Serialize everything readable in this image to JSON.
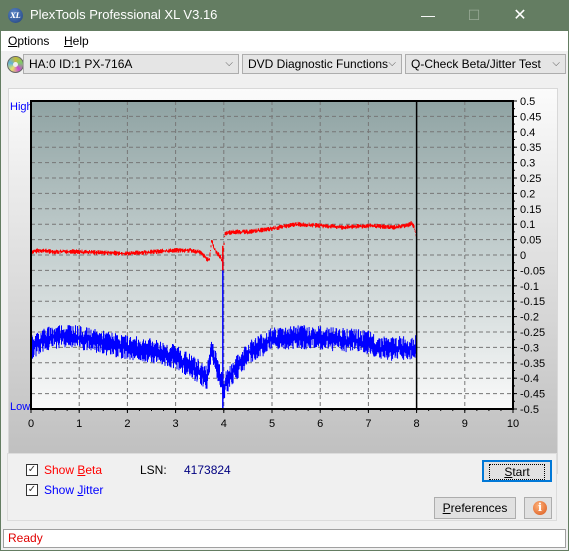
{
  "window": {
    "title": "PlexTools Professional XL V3.16",
    "app_icon": "XL",
    "controls": {
      "minimize": "—",
      "maximize": "☐",
      "close": "✕"
    }
  },
  "menu": {
    "items": [
      {
        "label": "Options",
        "accel": "O",
        "rest": "ptions"
      },
      {
        "label": "Help",
        "accel": "H",
        "rest": "elp"
      }
    ]
  },
  "toolbar": {
    "drive_icon": "disc-icon",
    "drive": "HA:0 ID:1  PX-716A",
    "function": "DVD Diagnostic Functions",
    "test": "Q-Check Beta/Jitter Test",
    "chevron": "⌵"
  },
  "chart_data": {
    "type": "line",
    "title": "",
    "xlabel": "",
    "ylabel": "",
    "left_axis_labels": {
      "high": "High",
      "low": "Low"
    },
    "xlim": [
      0,
      10
    ],
    "ylim": [
      -0.5,
      0.5
    ],
    "x_ticks": [
      0,
      1,
      2,
      3,
      4,
      5,
      6,
      7,
      8,
      9,
      10
    ],
    "y_ticks": [
      0.5,
      0.45,
      0.4,
      0.35,
      0.3,
      0.25,
      0.2,
      0.15,
      0.1,
      0.05,
      0,
      -0.05,
      -0.1,
      -0.15,
      -0.2,
      -0.25,
      -0.3,
      -0.35,
      -0.4,
      -0.45,
      -0.5
    ],
    "y_tick_labels": [
      "0.5",
      "0.45",
      "0.4",
      "0.35",
      "0.3",
      "0.25",
      "0.2",
      "0.15",
      "0.1",
      "0.05",
      "0",
      "-0.05",
      "-0.1",
      "-0.15",
      "-0.2",
      "-0.25",
      "-0.3",
      "-0.35",
      "-0.4",
      "-0.45",
      "-0.5"
    ],
    "grid": true,
    "marker_x": 8,
    "series": [
      {
        "name": "Beta",
        "color": "#ff0000",
        "x": [
          0,
          0.2,
          0.5,
          0.8,
          1.0,
          1.5,
          2.0,
          2.5,
          3.0,
          3.3,
          3.5,
          3.6,
          3.7,
          3.75,
          3.8,
          3.9,
          3.98,
          4.02,
          4.2,
          4.5,
          5.0,
          5.5,
          6.0,
          6.5,
          7.0,
          7.5,
          7.8,
          7.9,
          7.95,
          8.0
        ],
        "y": [
          0.01,
          0.015,
          0.01,
          0.012,
          0.01,
          0.008,
          0.005,
          0.01,
          0.015,
          0.015,
          0.01,
          -0.005,
          -0.02,
          0.05,
          0.02,
          0.0,
          -0.02,
          0.07,
          0.075,
          0.075,
          0.085,
          0.1,
          0.095,
          0.09,
          0.095,
          0.09,
          0.095,
          0.105,
          0.09,
          0.06
        ],
        "noise": 0.008
      },
      {
        "name": "Jitter",
        "color": "#0000ff",
        "x": [
          0,
          0.2,
          0.5,
          0.8,
          1.0,
          1.5,
          2.0,
          2.5,
          3.0,
          3.3,
          3.5,
          3.65,
          3.75,
          3.85,
          3.95,
          4.0,
          4.1,
          4.3,
          4.5,
          4.8,
          5.0,
          5.5,
          6.0,
          6.5,
          7.0,
          7.2,
          7.5,
          7.8,
          8.0
        ],
        "y": [
          -0.3,
          -0.28,
          -0.265,
          -0.26,
          -0.27,
          -0.285,
          -0.3,
          -0.31,
          -0.33,
          -0.36,
          -0.38,
          -0.4,
          -0.3,
          -0.36,
          -0.4,
          -0.43,
          -0.4,
          -0.36,
          -0.32,
          -0.29,
          -0.275,
          -0.265,
          -0.27,
          -0.275,
          -0.285,
          -0.3,
          -0.305,
          -0.3,
          -0.3
        ],
        "noise": 0.025
      }
    ]
  },
  "controls": {
    "show_beta": {
      "label": "Show Beta",
      "pre": "Show ",
      "accel": "B",
      "post": "eta",
      "checked": true,
      "color": "#ff0000"
    },
    "show_jitter": {
      "label": "Show Jitter",
      "pre": "Show ",
      "accel": "J",
      "post": "itter",
      "checked": true,
      "color": "#0000ff"
    },
    "lsn_label": "LSN:",
    "lsn_value": "4173824",
    "start": {
      "label": "Start",
      "accel": "S",
      "rest": "tart"
    },
    "preferences": {
      "label": "Preferences",
      "accel": "P",
      "rest": "references"
    },
    "info_icon": "i",
    "check_glyph": "✓"
  },
  "status": {
    "text": "Ready"
  }
}
